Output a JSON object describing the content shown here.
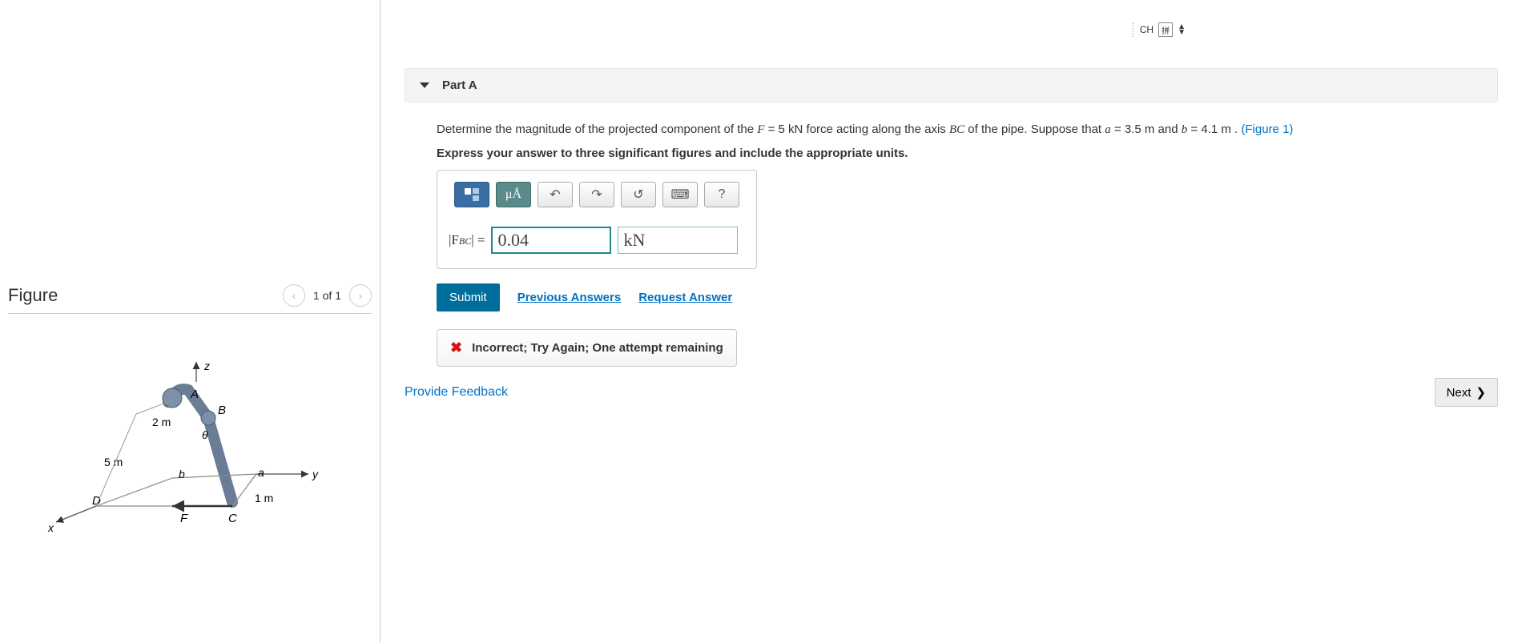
{
  "ime": {
    "lang": "CH",
    "grid": "拼"
  },
  "figure": {
    "title": "Figure",
    "pager": "1 of 1",
    "labels": {
      "z": "z",
      "y": "y",
      "x": "x",
      "A": "A",
      "B": "B",
      "C": "C",
      "D": "D",
      "F": "F",
      "a": "a",
      "b": "b",
      "theta": "θ",
      "d2m": "2 m",
      "d5m": "5 m",
      "d1m": "1 m"
    }
  },
  "part": {
    "title": "Part A",
    "text1a": "Determine the magnitude of the projected component of the ",
    "F_sym": "F",
    "F_eq": " = 5  kN",
    "text1b": " force acting along the axis ",
    "BC_sym": "BC",
    "text1c": " of the pipe. Suppose that ",
    "a_sym": "a",
    "a_eq": " = 3.5  m",
    "text1d": " and ",
    "b_sym": "b",
    "b_eq": " = 4.1  m",
    "text1e": " . ",
    "fig_link": "(Figure 1)",
    "instr": "Express your answer to three significant figures and include the appropriate units."
  },
  "toolbar": {
    "templates": "▯▯",
    "symbols": "μÅ",
    "undo": "↶",
    "redo": "↷",
    "reset": "↺",
    "keyboard": "⌨",
    "help": "?"
  },
  "answer": {
    "lhs_pre": "|",
    "lhs_var": "F",
    "lhs_sub": "BC",
    "lhs_post": "| = ",
    "value": "0.04",
    "unit": "kN"
  },
  "buttons": {
    "submit": "Submit",
    "prev": "Previous Answers",
    "req": "Request Answer"
  },
  "feedback": {
    "icon": "✖",
    "msg": "Incorrect; Try Again; One attempt remaining"
  },
  "bottom": {
    "provide": "Provide Feedback",
    "next": "Next"
  }
}
